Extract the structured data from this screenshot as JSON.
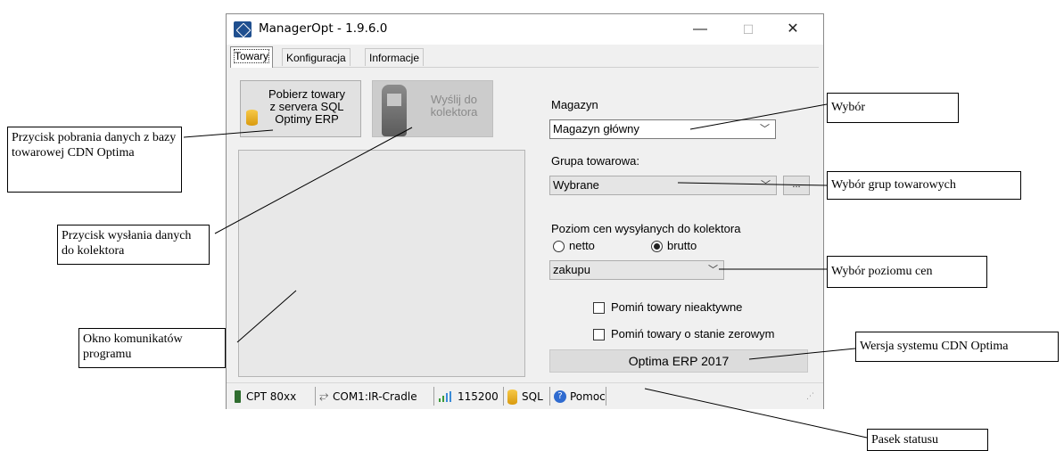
{
  "window": {
    "title": "ManagerOpt - 1.9.6.0",
    "controls": {
      "minimize": "—",
      "maximize": "☐",
      "close": "✕"
    }
  },
  "tabs": [
    {
      "label": "Towary",
      "active": true
    },
    {
      "label": "Konfiguracja",
      "active": false
    },
    {
      "label": "Informacje",
      "active": false
    }
  ],
  "buttons": {
    "fetch_line1": "Pobierz towary",
    "fetch_line2": "z servera SQL",
    "fetch_line3": "Optimy ERP",
    "send_line1": "Wyślij do",
    "send_line2": "kolektora",
    "dots": "..."
  },
  "form": {
    "warehouse_label": "Magazyn",
    "warehouse_value": "Magazyn główny",
    "group_label": "Grupa towarowa:",
    "group_value": "Wybrane",
    "price_level_label": "Poziom cen wysyłanych do kolektora",
    "radio_net": "netto",
    "radio_gross": "brutto",
    "selected_radio": "brutto",
    "price_value": "zakupu",
    "skip_inactive": "Pomiń towary nieaktywne",
    "skip_zero": "Pomiń towary o stanie zerowym",
    "erp_version": "Optima ERP 2017"
  },
  "status_bar": {
    "device": "CPT 80xx",
    "port": "COM1:IR-Cradle",
    "baud": "115200",
    "sql": "SQL",
    "help": "Pomoc"
  },
  "annotations": {
    "fetch": "Przycisk pobrania danych z bazy towarowej CDN Optima",
    "send": "Przycisk wysłania danych do kolektora",
    "messages": "Okno komunikatów programu",
    "select": "Wybór",
    "groups": "Wybór grup towarowych",
    "prices": "Wybór poziomu cen",
    "version": "Wersja systemu CDN Optima",
    "status": "Pasek statusu"
  },
  "colors": {
    "window_bg": "#f0f0f0",
    "title_bg": "#ffffff",
    "icon_blue": "#1f4f8f",
    "db_yellow": "#f0b72a"
  }
}
